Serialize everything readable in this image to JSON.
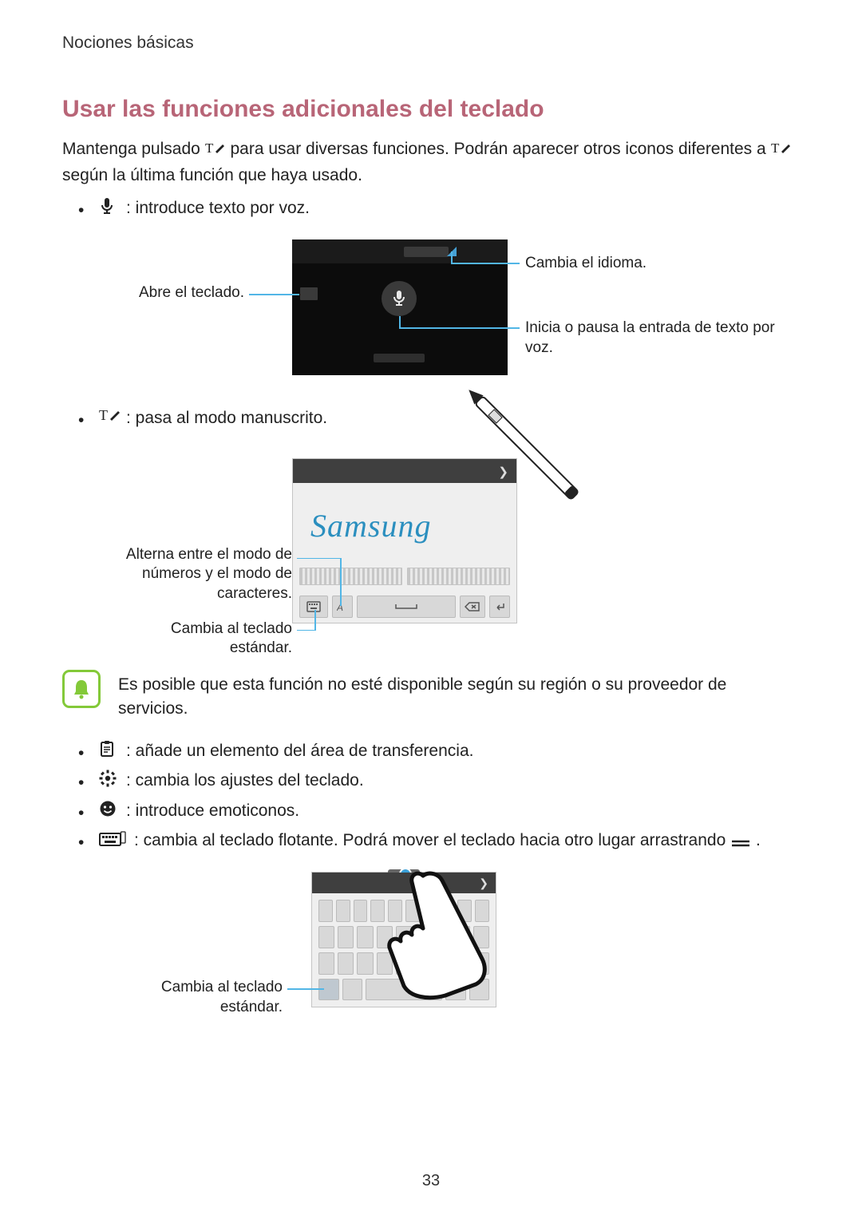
{
  "header": {
    "section": "Nociones básicas"
  },
  "title": "Usar las funciones adicionales del teclado",
  "intro_p1_a": "Mantenga pulsado ",
  "intro_p1_b": " para usar diversas funciones. Podrán aparecer otros iconos diferentes a ",
  "intro_p1_c": " según la última función que haya usado.",
  "bullets": {
    "voice": " : introduce texto por voz.",
    "handwriting": " : pasa al modo manuscrito.",
    "clipboard": " : añade un elemento del área de transferencia.",
    "settings": " : cambia los ajustes del teclado.",
    "emoji": " : introduce emoticonos.",
    "floating_a": " : cambia al teclado flotante. Podrá mover el teclado hacia otro lugar arrastrando ",
    "floating_b": "."
  },
  "voice_fig": {
    "left_label": "Abre el teclado.",
    "right_top": "Cambia el idioma.",
    "right_bottom": "Inicia o pausa la entrada de texto por voz."
  },
  "hand_fig": {
    "word": "Samsung",
    "left_top": "Alterna entre el modo de números y el modo de caracteres.",
    "left_bottom": "Cambia al teclado estándar."
  },
  "note": "Es posible que esta función no esté disponible según su región o su proveedor de servicios.",
  "float_fig": {
    "left_label": "Cambia al teclado estándar."
  },
  "page_number": "33"
}
